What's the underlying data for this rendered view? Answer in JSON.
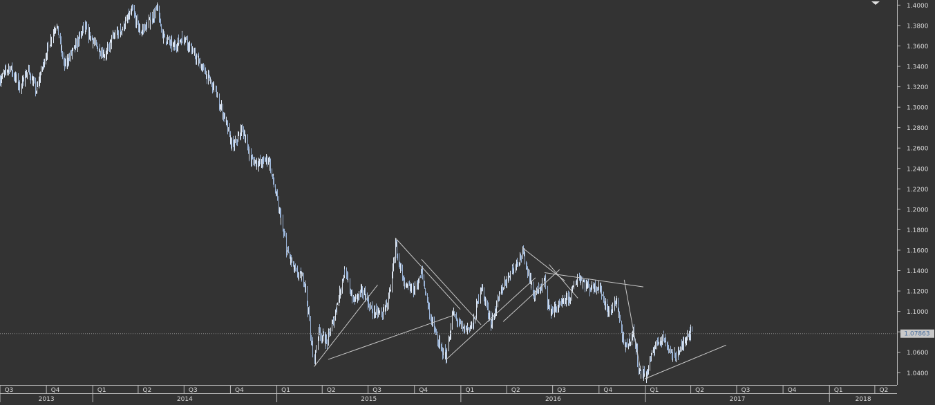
{
  "chart_data": {
    "type": "ohlc",
    "title": "",
    "colors": {
      "background": "#333333",
      "bars": "#9ab4d8",
      "bars_highlight": "#dde6f2",
      "trendlines": "#c8c8c8",
      "axis_text": "#d8d8d8",
      "last_price_box": "#c9c9c9",
      "last_price_text": "#4a6f9e"
    },
    "y_axis": {
      "position": "right",
      "range": [
        1.028,
        1.405
      ],
      "ticks": [
        "1.4000",
        "1.3800",
        "1.3600",
        "1.3400",
        "1.3200",
        "1.3000",
        "1.2800",
        "1.2600",
        "1.2400",
        "1.2200",
        "1.2000",
        "1.1800",
        "1.1600",
        "1.1400",
        "1.1200",
        "1.1000",
        "1.0800",
        "1.0600",
        "1.0400"
      ]
    },
    "x_axis": {
      "range": [
        "2013-07-01",
        "2018-05-15"
      ],
      "quarter_labels": [
        {
          "label": "Q3",
          "date": "2013-07-01"
        },
        {
          "label": "Q4",
          "date": "2013-10-01"
        },
        {
          "label": "Q1",
          "date": "2014-01-01"
        },
        {
          "label": "Q2",
          "date": "2014-04-01"
        },
        {
          "label": "Q3",
          "date": "2014-07-01"
        },
        {
          "label": "Q4",
          "date": "2014-10-01"
        },
        {
          "label": "Q1",
          "date": "2015-01-01"
        },
        {
          "label": "Q2",
          "date": "2015-04-01"
        },
        {
          "label": "Q3",
          "date": "2015-07-01"
        },
        {
          "label": "Q4",
          "date": "2015-10-01"
        },
        {
          "label": "Q1",
          "date": "2016-01-01"
        },
        {
          "label": "Q2",
          "date": "2016-04-01"
        },
        {
          "label": "Q3",
          "date": "2016-07-01"
        },
        {
          "label": "Q4",
          "date": "2016-10-01"
        },
        {
          "label": "Q1",
          "date": "2017-01-01"
        },
        {
          "label": "Q2",
          "date": "2017-04-01"
        },
        {
          "label": "Q3",
          "date": "2017-07-01"
        },
        {
          "label": "Q4",
          "date": "2017-10-01"
        },
        {
          "label": "Q1",
          "date": "2018-01-01"
        },
        {
          "label": "Q2",
          "date": "2018-04-01"
        }
      ],
      "year_labels": [
        {
          "label": "2013",
          "date": "2013-07-01"
        },
        {
          "label": "2014",
          "date": "2014-01-01"
        },
        {
          "label": "2015",
          "date": "2015-01-01"
        },
        {
          "label": "2016",
          "date": "2016-01-01"
        },
        {
          "label": "2017",
          "date": "2017-01-01"
        },
        {
          "label": "2018",
          "date": "2018-01-01"
        }
      ]
    },
    "last_price": "1.07863",
    "last_price_value": 1.0786,
    "price_path": [
      [
        "2013-07-01",
        1.327
      ],
      [
        "2013-07-20",
        1.34
      ],
      [
        "2013-08-10",
        1.318
      ],
      [
        "2013-08-25",
        1.337
      ],
      [
        "2013-09-10",
        1.316
      ],
      [
        "2013-09-30",
        1.352
      ],
      [
        "2013-10-20",
        1.383
      ],
      [
        "2013-11-05",
        1.34
      ],
      [
        "2013-11-25",
        1.357
      ],
      [
        "2013-12-15",
        1.379
      ],
      [
        "2014-01-05",
        1.361
      ],
      [
        "2014-01-25",
        1.351
      ],
      [
        "2014-02-10",
        1.368
      ],
      [
        "2014-03-01",
        1.378
      ],
      [
        "2014-03-20",
        1.395
      ],
      [
        "2014-04-05",
        1.373
      ],
      [
        "2014-04-25",
        1.385
      ],
      [
        "2014-05-08",
        1.396
      ],
      [
        "2014-05-20",
        1.37
      ],
      [
        "2014-06-10",
        1.359
      ],
      [
        "2014-06-30",
        1.37
      ],
      [
        "2014-07-20",
        1.352
      ],
      [
        "2014-08-10",
        1.335
      ],
      [
        "2014-09-01",
        1.316
      ],
      [
        "2014-09-20",
        1.287
      ],
      [
        "2014-10-05",
        1.26
      ],
      [
        "2014-10-25",
        1.28
      ],
      [
        "2014-11-10",
        1.248
      ],
      [
        "2014-11-30",
        1.245
      ],
      [
        "2014-12-15",
        1.25
      ],
      [
        "2015-01-01",
        1.21
      ],
      [
        "2015-01-20",
        1.16
      ],
      [
        "2015-02-05",
        1.14
      ],
      [
        "2015-02-25",
        1.13
      ],
      [
        "2015-03-15",
        1.05
      ],
      [
        "2015-03-25",
        1.08
      ],
      [
        "2015-04-10",
        1.07
      ],
      [
        "2015-04-25",
        1.095
      ],
      [
        "2015-05-15",
        1.14
      ],
      [
        "2015-06-01",
        1.11
      ],
      [
        "2015-06-20",
        1.12
      ],
      [
        "2015-07-10",
        1.1
      ],
      [
        "2015-07-30",
        1.098
      ],
      [
        "2015-08-15",
        1.12
      ],
      [
        "2015-08-24",
        1.168
      ],
      [
        "2015-09-10",
        1.125
      ],
      [
        "2015-09-30",
        1.12
      ],
      [
        "2015-10-15",
        1.138
      ],
      [
        "2015-11-01",
        1.095
      ],
      [
        "2015-11-20",
        1.065
      ],
      [
        "2015-12-03",
        1.055
      ],
      [
        "2015-12-15",
        1.098
      ],
      [
        "2016-01-05",
        1.082
      ],
      [
        "2016-01-25",
        1.087
      ],
      [
        "2016-02-10",
        1.125
      ],
      [
        "2016-03-01",
        1.088
      ],
      [
        "2016-03-20",
        1.12
      ],
      [
        "2016-04-10",
        1.14
      ],
      [
        "2016-05-03",
        1.158
      ],
      [
        "2016-05-25",
        1.115
      ],
      [
        "2016-06-15",
        1.13
      ],
      [
        "2016-06-24",
        1.1
      ],
      [
        "2016-07-15",
        1.105
      ],
      [
        "2016-08-05",
        1.115
      ],
      [
        "2016-08-20",
        1.135
      ],
      [
        "2016-09-10",
        1.123
      ],
      [
        "2016-09-30",
        1.125
      ],
      [
        "2016-10-20",
        1.098
      ],
      [
        "2016-11-05",
        1.11
      ],
      [
        "2016-11-20",
        1.062
      ],
      [
        "2016-12-08",
        1.08
      ],
      [
        "2016-12-20",
        1.04
      ],
      [
        "2017-01-03",
        1.038
      ],
      [
        "2017-01-20",
        1.068
      ],
      [
        "2017-02-05",
        1.075
      ],
      [
        "2017-02-25",
        1.055
      ],
      [
        "2017-03-10",
        1.062
      ],
      [
        "2017-03-27",
        1.08
      ],
      [
        "2017-04-03",
        1.0786
      ]
    ],
    "trendlines": [
      {
        "from": [
          "2015-03-16",
          1.046
        ],
        "to": [
          "2015-07-20",
          1.126
        ]
      },
      {
        "from": [
          "2015-04-13",
          1.053
        ],
        "to": [
          "2015-12-22",
          1.097
        ]
      },
      {
        "from": [
          "2015-08-24",
          1.172
        ],
        "to": [
          "2015-12-31",
          1.102
        ]
      },
      {
        "from": [
          "2015-10-15",
          1.151
        ],
        "to": [
          "2016-02-10",
          1.087
        ]
      },
      {
        "from": [
          "2015-12-03",
          1.053
        ],
        "to": [
          "2016-05-28",
          1.133
        ]
      },
      {
        "from": [
          "2016-03-25",
          1.09
        ],
        "to": [
          "2016-07-15",
          1.141
        ]
      },
      {
        "from": [
          "2016-05-03",
          1.162
        ],
        "to": [
          "2016-07-25",
          1.13
        ]
      },
      {
        "from": [
          "2016-06-15",
          1.138
        ],
        "to": [
          "2016-12-28",
          1.124
        ]
      },
      {
        "from": [
          "2016-06-24",
          1.146
        ],
        "to": [
          "2016-08-20",
          1.113
        ]
      },
      {
        "from": [
          "2016-11-20",
          1.131
        ],
        "to": [
          "2016-12-22",
          1.044
        ]
      },
      {
        "from": [
          "2016-12-31",
          1.034
        ],
        "to": [
          "2017-06-10",
          1.067
        ]
      }
    ]
  }
}
